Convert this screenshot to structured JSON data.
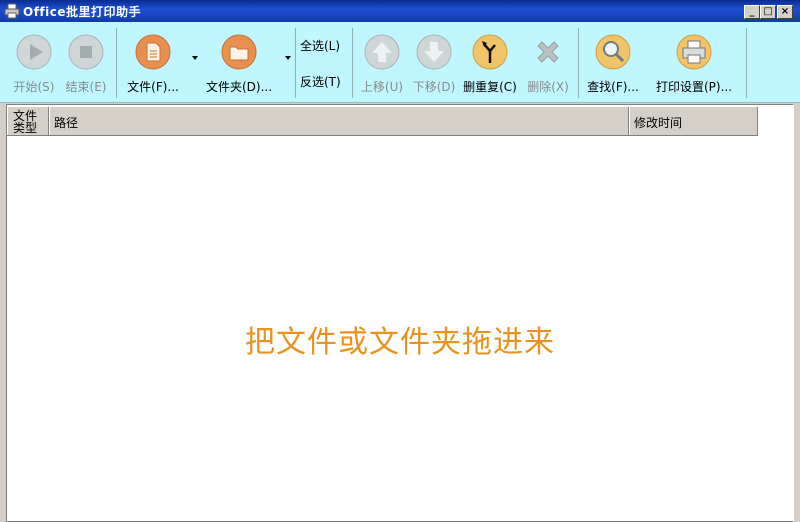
{
  "window": {
    "title": "Office批里打印助手"
  },
  "toolbar": {
    "start": "开始(S)",
    "stop": "结束(E)",
    "file": "文件(F)...",
    "folder": "文件夹(D)...",
    "select_all": "全选(L)",
    "invert_select": "反选(T)",
    "move_up": "上移(U)",
    "move_down": "下移(D)",
    "dedupe": "删重复(C)",
    "delete": "删除(X)",
    "find": "查找(F)...",
    "print_settings": "打印设置(P)..."
  },
  "table": {
    "columns": [
      "文件类型",
      "路径",
      "修改时间"
    ],
    "rows": []
  },
  "drop_hint": "把文件或文件夹拖进来",
  "colors": {
    "toolbar_bg": "#bff6ff",
    "accent_orange": "#e8931f",
    "titlebar": "#123aa8"
  }
}
